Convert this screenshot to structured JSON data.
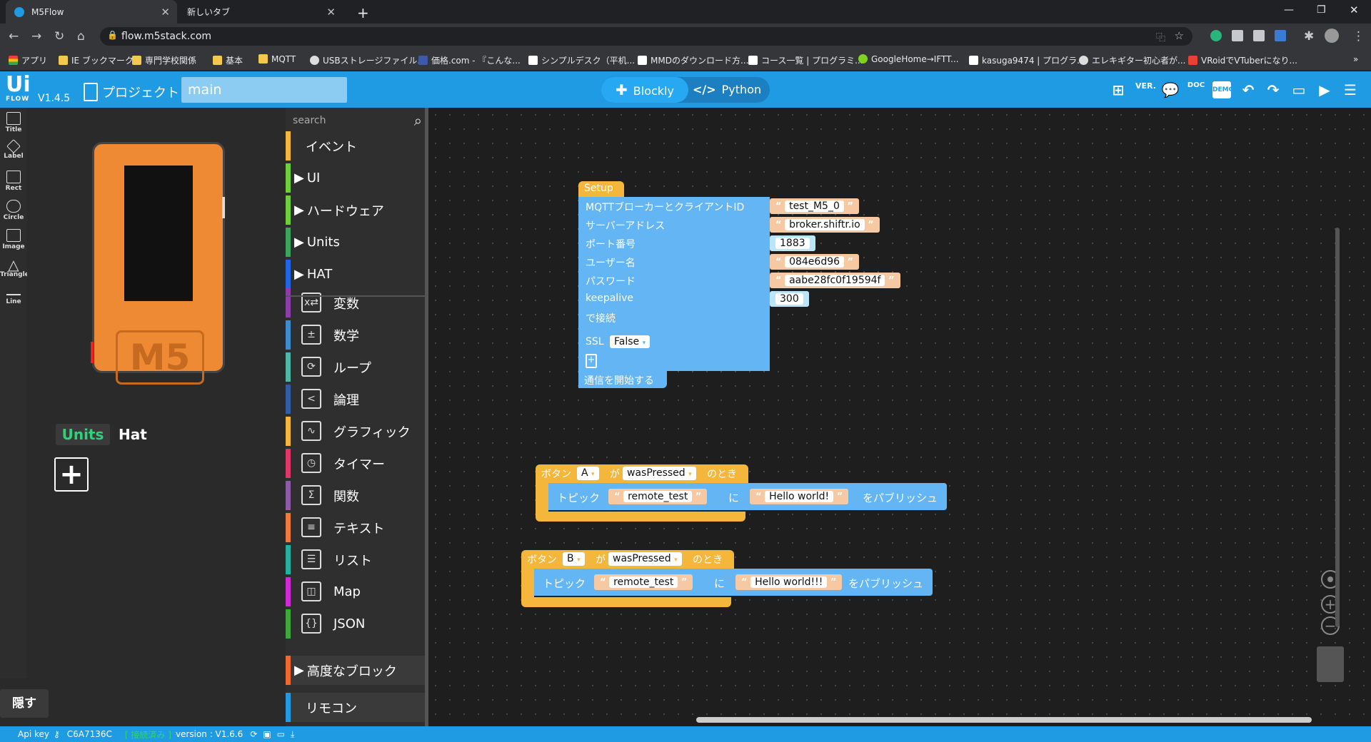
{
  "browser": {
    "tabs": [
      {
        "title": "M5Flow",
        "active": true
      },
      {
        "title": "新しいタブ",
        "active": false
      }
    ],
    "url": "flow.m5stack.com",
    "bookmarks": [
      "アプリ",
      "IE ブックマーク",
      "専門学校関係",
      "基本",
      "MQTT",
      "USBストレージファイル...",
      "価格.com - 『こんな...",
      "シンプルデスク（平机...",
      "MMDのダウンロード方...",
      "コース一覧 | プログラミ...",
      "GoogleHome→IFTT...",
      "kasuga9474 | プログラ...",
      "エレキギター初心者が...",
      "VRoidでVTuberになり..."
    ]
  },
  "app": {
    "logo_top": "Ui",
    "logo_bottom": "FLOW",
    "version": "V1.4.5",
    "project_label": "プロジェクト",
    "file_name": "main",
    "mode_blockly": "Blockly",
    "mode_python": "Python",
    "right_icons": [
      "new-file-icon",
      "version-icon",
      "comment-icon",
      "doc-icon",
      "demo-icon",
      "undo-icon",
      "redo-icon",
      "device-icon",
      "run-icon",
      "menu-icon"
    ],
    "ver_label": "VER.",
    "doc_label": "DOC",
    "demo_label": "DEMO"
  },
  "left_tools": [
    "Title",
    "Label",
    "Rect",
    "Circle",
    "Image",
    "Triangle",
    "Line"
  ],
  "hide_label": "隠す",
  "preview": {
    "device_label": "M5",
    "tabs": [
      "Units",
      "Hat"
    ]
  },
  "palette": {
    "search_placeholder": "search",
    "categories": [
      {
        "label": "イベント",
        "color": "#f4b73b",
        "arrow": false
      },
      {
        "label": "UI",
        "color": "#6fcf3a",
        "arrow": true
      },
      {
        "label": "ハードウェア",
        "color": "#6fcf3a",
        "arrow": true
      },
      {
        "label": "Units",
        "color": "#3aa65a",
        "arrow": true
      },
      {
        "label": "HAT",
        "color": "#1e68e3",
        "arrow": true
      },
      {
        "label": "変数",
        "color": "#8e3ea8",
        "icon": "x⇄"
      },
      {
        "label": "数学",
        "color": "#3c8ccf",
        "icon": "±"
      },
      {
        "label": "ループ",
        "color": "#4fb8a4",
        "icon": "⟳"
      },
      {
        "label": "論理",
        "color": "#2f5da8",
        "icon": "<"
      },
      {
        "label": "グラフィック",
        "color": "#f4b73b",
        "icon": "∿"
      },
      {
        "label": "タイマー",
        "color": "#e2356a",
        "icon": "◷"
      },
      {
        "label": "関数",
        "color": "#8f5aa8",
        "icon": "Σ"
      },
      {
        "label": "テキスト",
        "color": "#ef7a3c",
        "icon": "≡"
      },
      {
        "label": "リスト",
        "color": "#26b0a0",
        "icon": "☰"
      },
      {
        "label": "Map",
        "color": "#d12ad6",
        "icon": "◫"
      },
      {
        "label": "JSON",
        "color": "#3ea83a",
        "icon": "{}"
      }
    ],
    "advanced": {
      "label": "高度なブロック",
      "color": "#ef6a2c"
    },
    "remote": {
      "label": "リモコン",
      "color": "#1f9be3"
    }
  },
  "blocks": {
    "setup": {
      "header": "Setup",
      "rows": [
        {
          "label": "MQTTブローカーとクライアントID",
          "value": "test_M5_0",
          "kind": "str"
        },
        {
          "label": "サーバーアドレス",
          "value": "broker.shiftr.io",
          "kind": "str"
        },
        {
          "label": "ポート番号",
          "value": "1883",
          "kind": "num"
        },
        {
          "label": "ユーザー名",
          "value": "084e6d96",
          "kind": "str"
        },
        {
          "label": "パスワード",
          "value": "aabe28fc0f19594f",
          "kind": "str"
        },
        {
          "label": "keepalive",
          "value": "300",
          "kind": "num"
        },
        {
          "label": "で接続",
          "value": "",
          "kind": "none"
        }
      ],
      "ssl_label": "SSL",
      "ssl_value": "False",
      "start_label": "通信を開始する"
    },
    "events": [
      {
        "prefix": "ボタン",
        "button": "A",
        "ga": "が",
        "event": "wasPressed",
        "suffix": "のとき",
        "topic_label": "トピック",
        "topic": "remote_test",
        "ni": "に",
        "message": "Hello world!",
        "publish": "をパブリッシュ"
      },
      {
        "prefix": "ボタン",
        "button": "B",
        "ga": "が",
        "event": "wasPressed",
        "suffix": "のとき",
        "topic_label": "トピック",
        "topic": "remote_test",
        "ni": "に",
        "message": "Hello world!!!",
        "publish": "をパブリッシュ"
      }
    ]
  },
  "status": {
    "api_key_label": "Api key",
    "api_key": "C6A7136C",
    "connection": "接続済み",
    "version_label": "version : V1.6.6"
  }
}
